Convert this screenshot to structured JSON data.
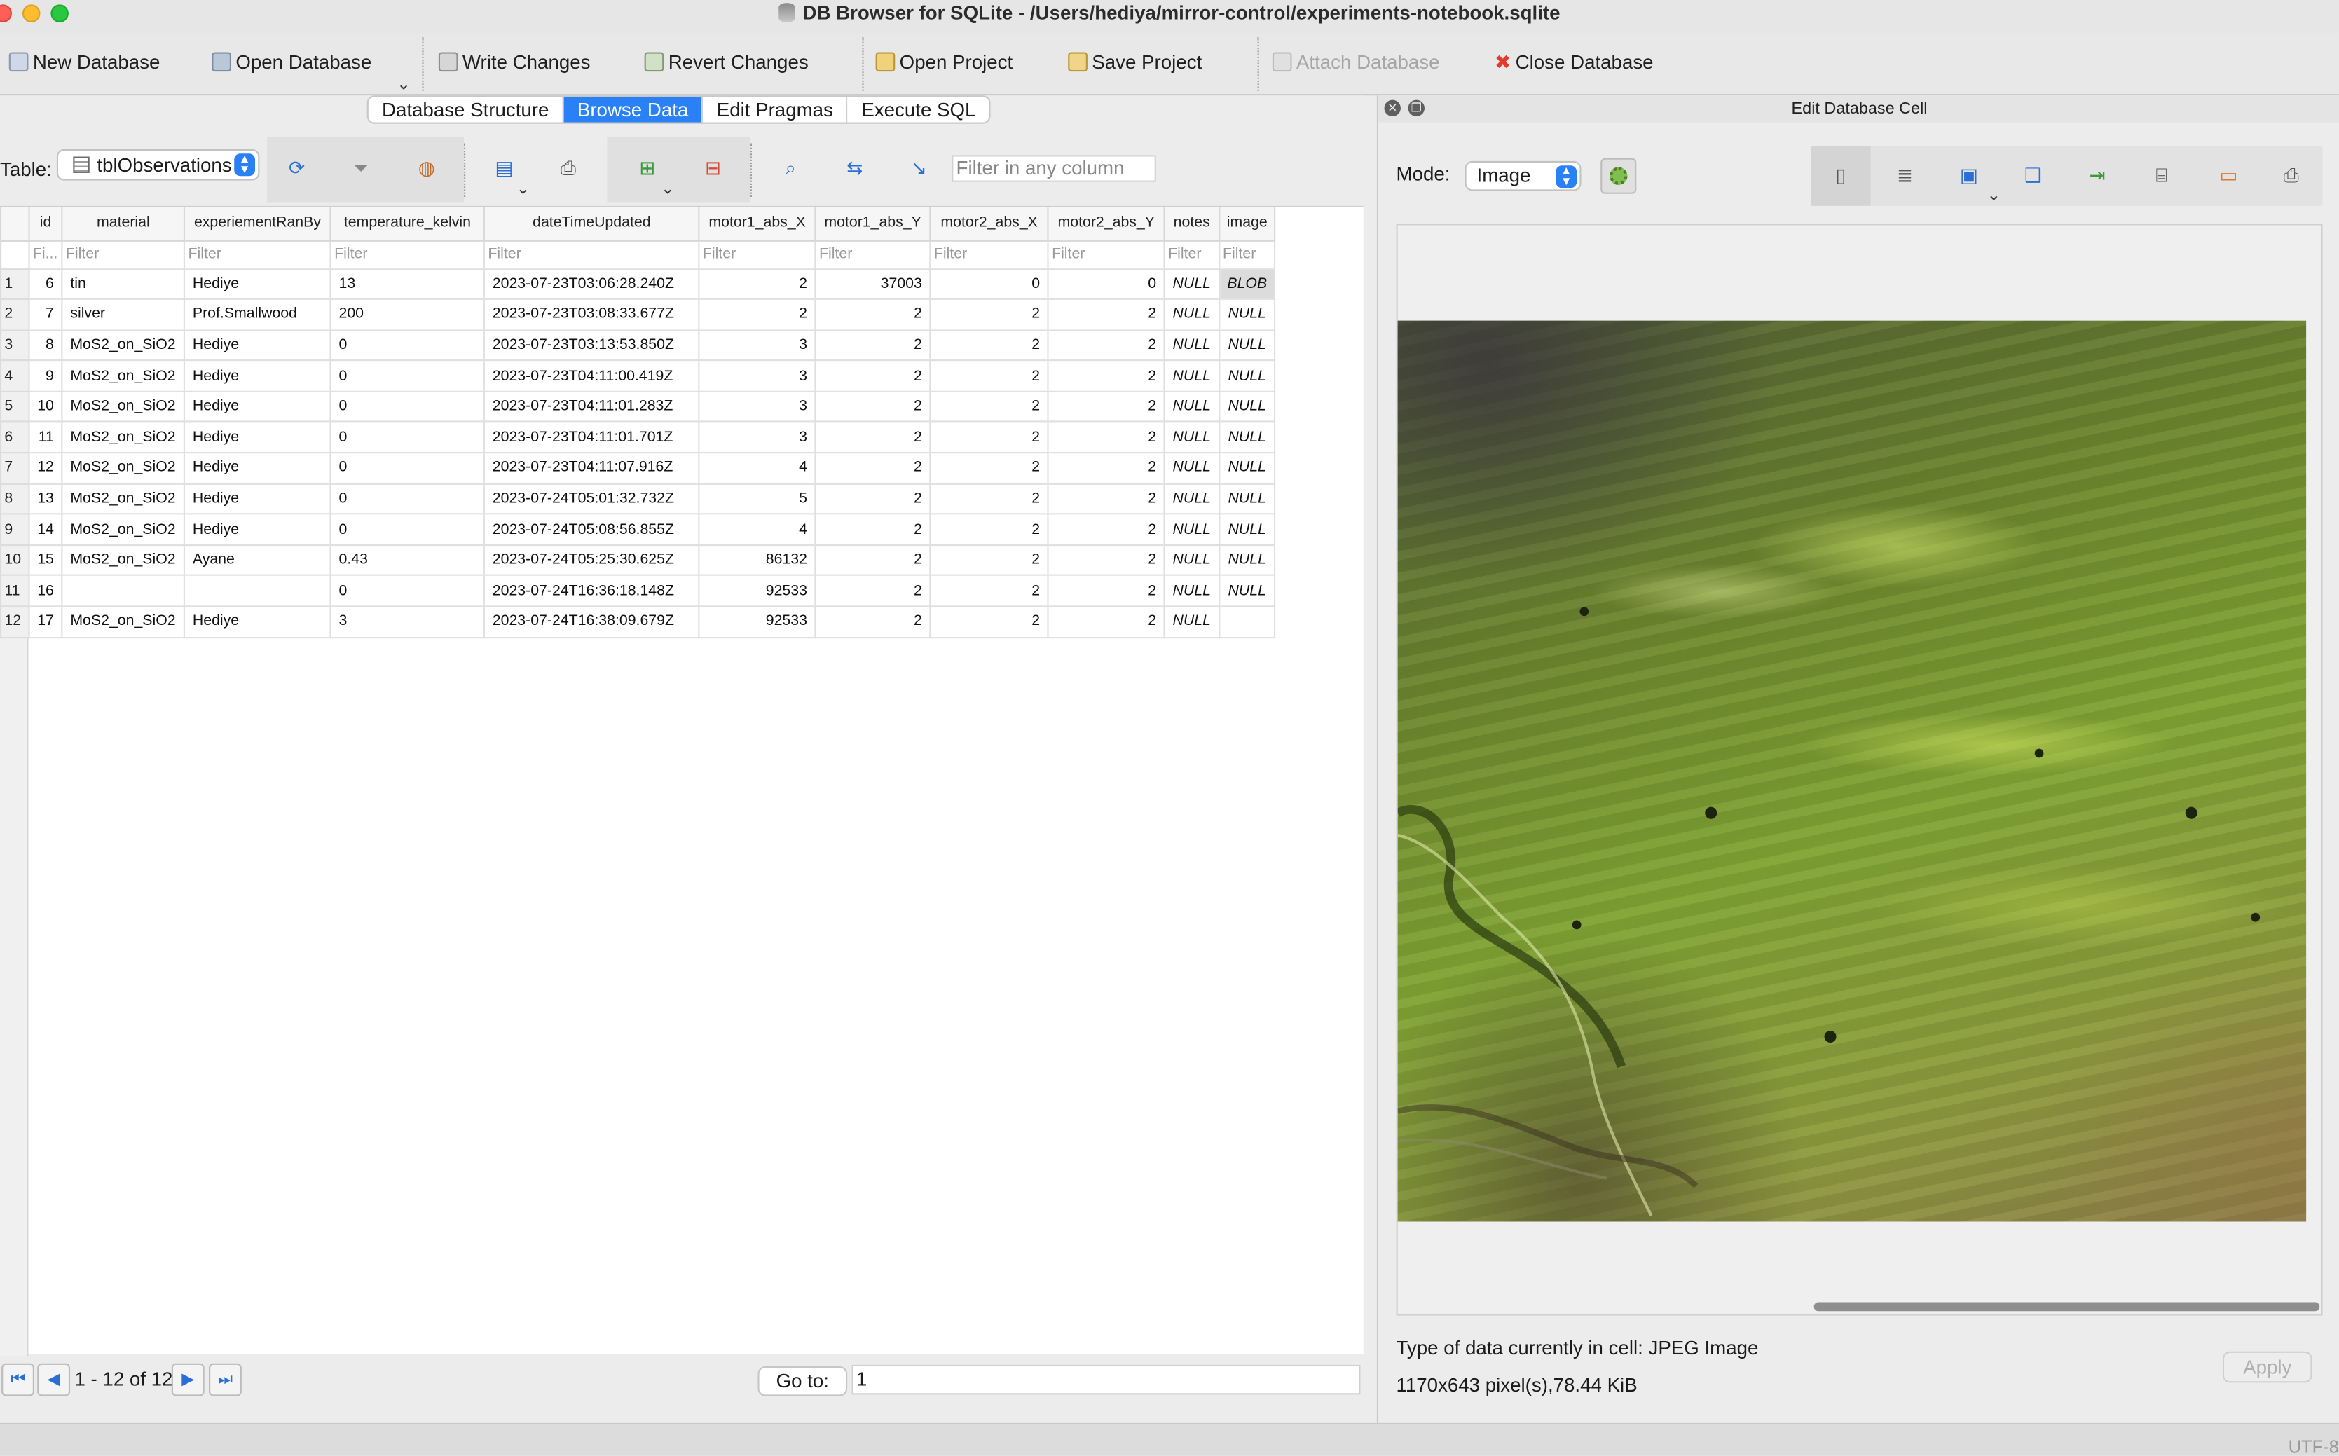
{
  "window": {
    "title": "DB Browser for SQLite - /Users/hediya/mirror-control/experiments-notebook.sqlite"
  },
  "toolbar": {
    "new_database": "New Database",
    "open_database": "Open Database",
    "write_changes": "Write Changes",
    "revert_changes": "Revert Changes",
    "open_project": "Open Project",
    "save_project": "Save Project",
    "attach_database": "Attach Database",
    "close_database": "Close Database"
  },
  "tabs": [
    "Database Structure",
    "Browse Data",
    "Edit Pragmas",
    "Execute SQL"
  ],
  "active_tab": "Browse Data",
  "browse": {
    "table_label": "Table:",
    "table_name": "tblObservations",
    "filter_placeholder": "Filter in any column",
    "columns": [
      "id",
      "material",
      "experiementRanBy",
      "temperature_kelvin",
      "dateTimeUpdated",
      "motor1_abs_X",
      "motor1_abs_Y",
      "motor2_abs_X",
      "motor2_abs_Y",
      "notes",
      "image"
    ],
    "filter_labels": [
      "Fi...",
      "Filter",
      "Filter",
      "Filter",
      "Filter",
      "Filter",
      "Filter",
      "Filter",
      "Filter",
      "Filter",
      "Filter"
    ],
    "rows": [
      [
        "1",
        "6",
        "tin",
        "Hediye",
        "13",
        "2023-07-23T03:06:28.240Z",
        "2",
        "37003",
        "0",
        "0",
        "NULL",
        "BLOB"
      ],
      [
        "2",
        "7",
        "silver",
        "Prof.Smallwood",
        "200",
        "2023-07-23T03:08:33.677Z",
        "2",
        "2",
        "2",
        "2",
        "NULL",
        "NULL"
      ],
      [
        "3",
        "8",
        "MoS2_on_SiO2",
        "Hediye",
        "0",
        "2023-07-23T03:13:53.850Z",
        "3",
        "2",
        "2",
        "2",
        "NULL",
        "NULL"
      ],
      [
        "4",
        "9",
        "MoS2_on_SiO2",
        "Hediye",
        "0",
        "2023-07-23T04:11:00.419Z",
        "3",
        "2",
        "2",
        "2",
        "NULL",
        "NULL"
      ],
      [
        "5",
        "10",
        "MoS2_on_SiO2",
        "Hediye",
        "0",
        "2023-07-23T04:11:01.283Z",
        "3",
        "2",
        "2",
        "2",
        "NULL",
        "NULL"
      ],
      [
        "6",
        "11",
        "MoS2_on_SiO2",
        "Hediye",
        "0",
        "2023-07-23T04:11:01.701Z",
        "3",
        "2",
        "2",
        "2",
        "NULL",
        "NULL"
      ],
      [
        "7",
        "12",
        "MoS2_on_SiO2",
        "Hediye",
        "0",
        "2023-07-23T04:11:07.916Z",
        "4",
        "2",
        "2",
        "2",
        "NULL",
        "NULL"
      ],
      [
        "8",
        "13",
        "MoS2_on_SiO2",
        "Hediye",
        "0",
        "2023-07-24T05:01:32.732Z",
        "5",
        "2",
        "2",
        "2",
        "NULL",
        "NULL"
      ],
      [
        "9",
        "14",
        "MoS2_on_SiO2",
        "Hediye",
        "0",
        "2023-07-24T05:08:56.855Z",
        "4",
        "2",
        "2",
        "2",
        "NULL",
        "NULL"
      ],
      [
        "10",
        "15",
        "MoS2_on_SiO2",
        "Ayane",
        "0.43",
        "2023-07-24T05:25:30.625Z",
        "86132",
        "2",
        "2",
        "2",
        "NULL",
        "NULL"
      ],
      [
        "11",
        "16",
        "",
        "",
        "0",
        "2023-07-24T16:36:18.148Z",
        "92533",
        "2",
        "2",
        "2",
        "NULL",
        "NULL"
      ],
      [
        "12",
        "17",
        "MoS2_on_SiO2",
        "Hediye",
        "3",
        "2023-07-24T16:38:09.679Z",
        "92533",
        "2",
        "2",
        "2",
        "NULL",
        ""
      ]
    ],
    "pager_label": "1 - 12 of 12",
    "goto_label": "Go to:",
    "goto_value": "1"
  },
  "edit_cell": {
    "title": "Edit Database Cell",
    "mode_label": "Mode:",
    "mode_value": "Image",
    "data_type": "Type of data currently in cell: JPEG Image",
    "image_info": "1170x643 pixel(s),78.44 KiB",
    "apply": "Apply"
  },
  "status": {
    "encoding": "UTF-8"
  },
  "icons": [
    "database-icon",
    "open-folder-icon",
    "write-icon",
    "revert-icon",
    "project-icon",
    "save-project-icon",
    "attach-icon",
    "close-x-icon",
    "refresh-icon",
    "clear-filter-icon",
    "save-filter-icon",
    "print-icon",
    "insert-record-icon",
    "delete-record-icon",
    "find-icon",
    "find-replace-icon"
  ]
}
